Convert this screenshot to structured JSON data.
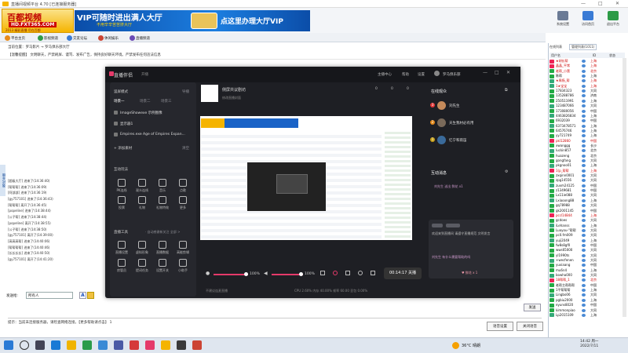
{
  "window": {
    "title": "直播间视频平台 4.70 [已连接服务器]",
    "controls": [
      "—",
      "□",
      "✕"
    ]
  },
  "logo": {
    "line1": "百都视频",
    "line2": "HD.FXT365.COM",
    "line3": "2013 精彩直播 尽在百都"
  },
  "banner": {
    "line1": "VIP可随时进出满人大厅",
    "line2": "不用辛辛苦苦挤大厅",
    "line3": "点这里办理大厅VIP"
  },
  "top_buttons": [
    {
      "label": "系统设置",
      "color": "#6a7a95"
    },
    {
      "label": "访问首页",
      "color": "#3a7bd5"
    },
    {
      "label": "退出平台",
      "color": "#2d9b47"
    }
  ],
  "tabs": [
    {
      "label": "平台主页",
      "color": "#e88a1a"
    },
    {
      "label": "影视频道",
      "color": "#2d9b47"
    },
    {
      "label": "交友论坛",
      "color": "#3a7bd5"
    },
    {
      "label": "休闲娱乐",
      "color": "#c43"
    },
    {
      "label": "直播频道",
      "color": "#6a4ab5"
    }
  ],
  "nav": {
    "text": "当前位置：罗马影片 → 罗马俱乐部大厅"
  },
  "notice": {
    "text": "【温馨提醒】 文明聊天，严禁刷屏、谩骂、发布广告，保持良好聊天环境。严禁发布任何违法信息"
  },
  "sidebar_label": "聊天对象",
  "chat_log": [
    "[超级大厅] 进来了(14:36:40)",
    "[帮帮帮] 进来了(14:36:09)",
    "[阿部部] 进来了(14:36:19)",
    "[gy757101] 进来了(14:36:43)",
    "[帮帮帮] 离开了(14:36:45)",
    "[popeline] 进来了(14:38:44)",
    "[公子帮] 进来了(14:38:44)",
    "[popeline] 离开了(14:38:55)",
    "[公子帮] 进来了(14:38:50)",
    "[gy757101] 离开了(14:39:00)",
    "[高高高帮] 进来了(14:40:06)",
    "[帮帮帮帮] 进来了(14:40:46)",
    "[长长长长] 进来了(14:40:50)",
    "[gy757101] 离开了(14:41:20)"
  ],
  "input": {
    "send_to_label": "发送给:",
    "send_to_value": "所有人",
    "send_button": "发送"
  },
  "tip": "提示：当前未连接服务器，请检查网络连接。【更多帮助请点击】 1",
  "bottom_buttons": {
    "left": "语音设置",
    "right": "关闭语音"
  },
  "right_panel": {
    "tabs": [
      "在线列表",
      "管理列表(1011)"
    ],
    "headers": [
      "用户名",
      "ID",
      "状态"
    ]
  },
  "users": [
    {
      "name": "★胡长帮",
      "area": "上海",
      "color": "#c00",
      "av": "#e25"
    },
    {
      "name": "晶晶_平常",
      "area": "上海",
      "color": "#c00",
      "av": "#e25"
    },
    {
      "name": "老帮_小营",
      "area": "北京",
      "color": "#c00",
      "av": "#2a4"
    },
    {
      "name": "陈帮",
      "area": "上海",
      "color": "#111",
      "av": "#2a4"
    },
    {
      "name": "★周扬_帮",
      "area": "上海",
      "color": "#c00",
      "av": "#3a7"
    },
    {
      "name": "1★宝宝",
      "area": "上海",
      "color": "#c00",
      "av": "#3a7"
    },
    {
      "name": "17834323",
      "area": "大同",
      "color": "#111",
      "av": "#2a4"
    },
    {
      "name": "135288786",
      "area": "济南",
      "color": "#111",
      "av": "#2a4"
    },
    {
      "name": "250511991",
      "area": "上海",
      "color": "#111",
      "av": "#2a4"
    },
    {
      "name": "123487066",
      "area": "大同",
      "color": "#111",
      "av": "#3a7"
    },
    {
      "name": "173080056",
      "area": "中国",
      "color": "#111",
      "av": "#2a4"
    },
    {
      "name": "4463826834",
      "area": "上海",
      "color": "#111",
      "av": "#3a7"
    },
    {
      "name": "6932039",
      "area": "中国",
      "color": "#111",
      "av": "#2a4"
    },
    {
      "name": "6373478571",
      "area": "上海",
      "color": "#111",
      "av": "#3a7"
    },
    {
      "name": "64576746",
      "area": "上海",
      "color": "#111",
      "av": "#2a4"
    },
    {
      "name": "yy721749",
      "area": "上海",
      "color": "#111",
      "av": "#2a4"
    },
    {
      "name": "pkl12860",
      "area": "中国",
      "color": "#c00",
      "av": "#e25"
    },
    {
      "name": "xwanggg",
      "area": "长沙",
      "color": "#111",
      "av": "#2a4"
    },
    {
      "name": "luckin857",
      "area": "北京",
      "color": "#111",
      "av": "#3a7"
    },
    {
      "name": "huazeng",
      "area": "北京",
      "color": "#111",
      "av": "#2a4"
    },
    {
      "name": "gongfang",
      "area": "大同",
      "color": "#111",
      "av": "#2a4"
    },
    {
      "name": "pkgnoo01",
      "area": "上海",
      "color": "#111",
      "av": "#3a7"
    },
    {
      "name": "1(p_帮帮",
      "area": "上海",
      "color": "#c00",
      "av": "#e25"
    },
    {
      "name": "zxqinn0001",
      "area": "大同",
      "color": "#111",
      "av": "#2a4"
    },
    {
      "name": "zpg14556",
      "area": "大同",
      "color": "#111",
      "av": "#2a4"
    },
    {
      "name": "zuxm24125",
      "area": "中国",
      "color": "#111",
      "av": "#3a7"
    },
    {
      "name": "z1349681",
      "area": "中国",
      "color": "#111",
      "av": "#2a4"
    },
    {
      "name": "Lx11ie088",
      "area": "大同",
      "color": "#111",
      "av": "#2a4"
    },
    {
      "name": "Lxiaoong88",
      "area": "上海",
      "color": "#111",
      "av": "#3a7"
    },
    {
      "name": "gq78988",
      "area": "大同",
      "color": "#111",
      "av": "#2a4"
    },
    {
      "name": "gk2001145",
      "area": "中国",
      "color": "#111",
      "av": "#2a4"
    },
    {
      "name": "pccl14844",
      "area": "上海",
      "color": "#c00",
      "av": "#e25"
    },
    {
      "name": "gcdoes",
      "area": "大同",
      "color": "#111",
      "av": "#2a4"
    },
    {
      "name": "iLehanss",
      "area": "上海",
      "color": "#111",
      "av": "#3a7"
    },
    {
      "name": "Luoyou-\"帮帮",
      "area": "大同",
      "color": "#111",
      "av": "#2a4"
    },
    {
      "name": "pc0.fm009",
      "area": "大同",
      "color": "#111",
      "av": "#2a4"
    },
    {
      "name": "yuji2049",
      "area": "上海",
      "color": "#111",
      "av": "#3a7"
    },
    {
      "name": "fw8s8gf0",
      "area": "中国",
      "color": "#111",
      "av": "#2a4"
    },
    {
      "name": "wws65000",
      "area": "大同",
      "color": "#111",
      "av": "#2a4"
    },
    {
      "name": "yl1990ts",
      "area": "大同",
      "color": "#111",
      "av": "#2a4"
    },
    {
      "name": "+wecfenen",
      "area": "大同",
      "color": "#111",
      "av": "#3a7"
    },
    {
      "name": "yuxiaang",
      "area": "中国",
      "color": "#111",
      "av": "#2a4"
    },
    {
      "name": "mu6n4",
      "area": "上海",
      "color": "#111",
      "av": "#2a4"
    },
    {
      "name": "bowha000",
      "area": "大同",
      "color": "#111",
      "av": "#3a7"
    },
    {
      "name": "18帮帮_1",
      "area": "北京",
      "color": "#c00",
      "av": "#e25"
    },
    {
      "name": "老帮主帮帮帮",
      "area": "中国",
      "color": "#111",
      "av": "#2a4"
    },
    {
      "name": "1平帮帮帮",
      "area": "上海",
      "color": "#111",
      "av": "#2a4"
    },
    {
      "name": "Lingbo06",
      "area": "大同",
      "color": "#111",
      "av": "#3a7"
    },
    {
      "name": "pgbiu2000",
      "area": "上海",
      "color": "#111",
      "av": "#2a4"
    },
    {
      "name": "eyuns8020",
      "area": "中国",
      "color": "#111",
      "av": "#2a4"
    },
    {
      "name": "kimmonpiao",
      "area": "大同",
      "color": "#111",
      "av": "#2a4"
    },
    {
      "name": "Lp2015109",
      "area": "上海",
      "color": "#111",
      "av": "#3a7"
    }
  ],
  "live_app": {
    "title": "直播伴侣",
    "subtitle": "开播",
    "left": {
      "mode": "竖屏模式",
      "mode_right": "导播",
      "scene_tabs": [
        "场景一",
        "场景二",
        "场景三"
      ],
      "sources": [
        "ImageShowexe 示例图像",
        "显示器1",
        "Empires.exe Age of Empires Expan..."
      ],
      "add_source": "+ 添加素材",
      "add_right": "清空",
      "interact_title": "互动玩法",
      "interact": [
        "PK连线",
        "观众连线",
        "音乐",
        "点歌",
        "投票",
        "礼物",
        "礼物特效",
        "更多"
      ],
      "tools_title": "直播工具",
      "tools_note": "· 自动感谢新关注 全部 >",
      "tools": [
        "直播设置",
        "虚拟形象",
        "直播数据",
        "高能剪辑",
        "房管员",
        "提词任务",
        "设置开关",
        "小助手"
      ]
    },
    "main": {
      "room_title": "侧屏共议剧坊",
      "room_sub": "修改直播封面",
      "header_right": [
        "主播中心",
        "帮助",
        "设置"
      ],
      "counters": [
        "0",
        "0",
        "0"
      ]
    },
    "bottom": {
      "mic_pct": "100%",
      "spk_pct": "100%",
      "timer": "00:14:17",
      "live_btn": "关播",
      "status": "CPU 2.60%  内存 40.00%  帧率 60.00  丢包 0.00%",
      "hint": "不建议连麦直播"
    },
    "right": {
      "audience_title": "在线观众",
      "audience": [
        {
          "name": "刘先生",
          "badge": "3"
        },
        {
          "name": "天生我材必有用",
          "badge": "2"
        },
        {
          "name": "忆宁和雨笛",
          "badge": "1"
        }
      ],
      "msg_title": "互动消息",
      "msg_lines": [
        "刘先生  送出 鲜花 x1",
        "欢迎来到直播间 请遵守直播规范 文明发言",
        "刘先生 有什么需要帮助的吗"
      ],
      "gift": "♥ 鲜花 x 1"
    }
  },
  "taskbar": {
    "weather": "36°C 晴朗",
    "time": "14:42 周一",
    "date": "2022/7/11"
  }
}
